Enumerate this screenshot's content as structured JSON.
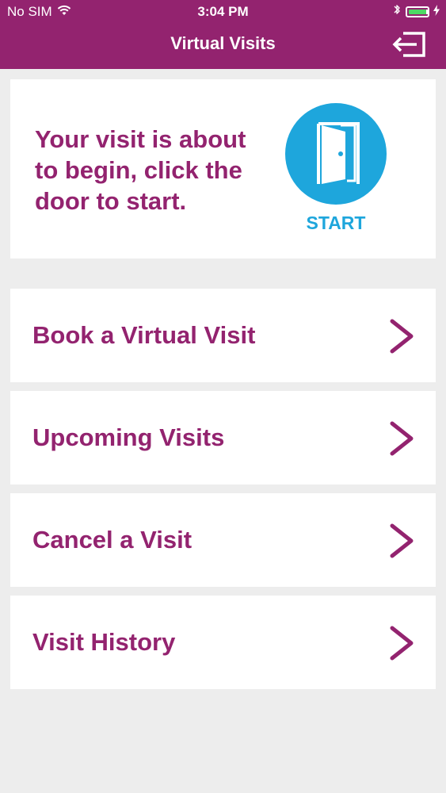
{
  "status_bar": {
    "carrier": "No SIM",
    "time": "3:04 PM",
    "wifi_icon": "wifi-icon",
    "bluetooth_icon": "bluetooth-icon",
    "battery_icon": "battery-icon",
    "charging_icon": "charging-bolt-icon"
  },
  "header": {
    "title": "Virtual Visits",
    "logout_icon": "logout-icon"
  },
  "start_card": {
    "message": "Your visit is about to begin, click the door to start.",
    "button_label": "START",
    "icon": "door-icon"
  },
  "menu": {
    "items": [
      {
        "label": "Book a Virtual Visit",
        "icon": "chevron-right-icon"
      },
      {
        "label": "Upcoming Visits",
        "icon": "chevron-right-icon"
      },
      {
        "label": "Cancel a Visit",
        "icon": "chevron-right-icon"
      },
      {
        "label": "Visit History",
        "icon": "chevron-right-icon"
      }
    ]
  },
  "colors": {
    "brand": "#93236f",
    "accent": "#1ea6dc",
    "background": "#ededed",
    "card": "#ffffff"
  }
}
